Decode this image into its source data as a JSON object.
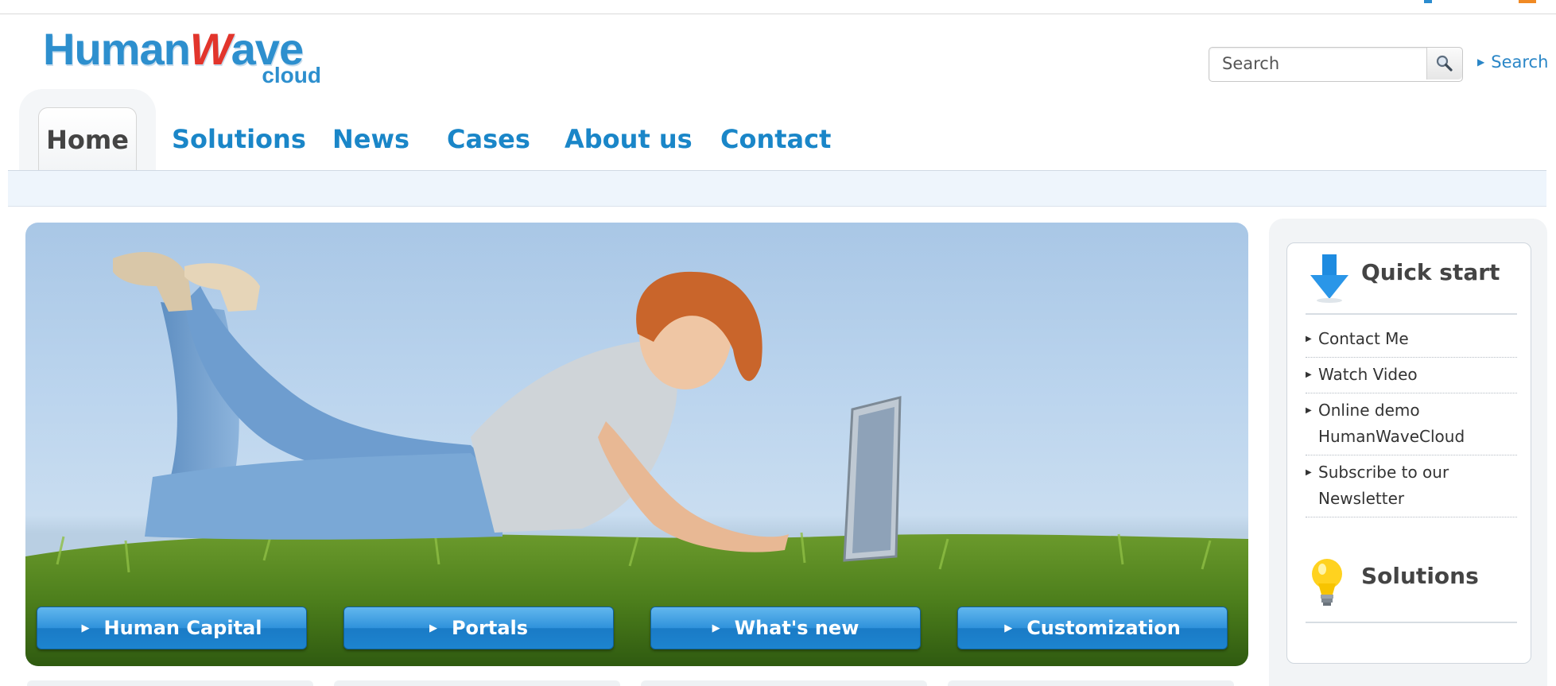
{
  "brand": {
    "name_part1": "Human",
    "name_part2": "W",
    "name_part3": "ave",
    "subtitle": "cloud"
  },
  "search": {
    "placeholder": "Search",
    "link_label": "Search"
  },
  "nav": {
    "tabs": [
      "Home",
      "Solutions",
      "News",
      "Cases",
      "About us",
      "Contact"
    ],
    "active": "Home"
  },
  "hero": {
    "buttons": [
      "Human Capital",
      "Portals",
      "What's new",
      "Customization"
    ]
  },
  "sidebar": {
    "quick_start_title": "Quick start",
    "items": [
      [
        "Contact Me"
      ],
      [
        "Watch Video"
      ],
      [
        "Online demo",
        "HumanWaveCloud"
      ],
      [
        "Subscribe to our",
        "Newsletter"
      ]
    ],
    "solutions_title": "Solutions"
  },
  "colors": {
    "accent": "#1a86c8",
    "logo_blue": "#2d8fce",
    "logo_red": "#e2352c",
    "button_blue": "#1d84cf"
  },
  "icons": {
    "search": "magnifier-icon",
    "quick_start": "arrow-down-icon",
    "solutions": "lightbulb-icon"
  }
}
